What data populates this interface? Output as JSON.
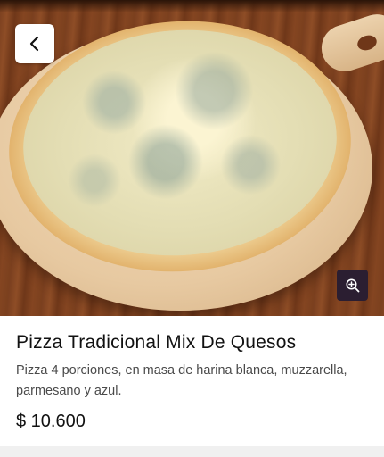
{
  "hero": {
    "image_alt": "Pizza con queso azul sobre tabla de madera",
    "back_icon": "chevron-left-icon",
    "zoom_icon": "zoom-in-icon"
  },
  "product": {
    "title": "Pizza Tradicional Mix De Quesos",
    "description": "Pizza 4 porciones, en masa de harina blanca, muzzarella, parmesano y azul.",
    "price": "$ 10.600"
  },
  "colors": {
    "zoom_button_bg": "#2b1e31",
    "text_primary": "#111111",
    "text_secondary": "#4a4a4a"
  }
}
